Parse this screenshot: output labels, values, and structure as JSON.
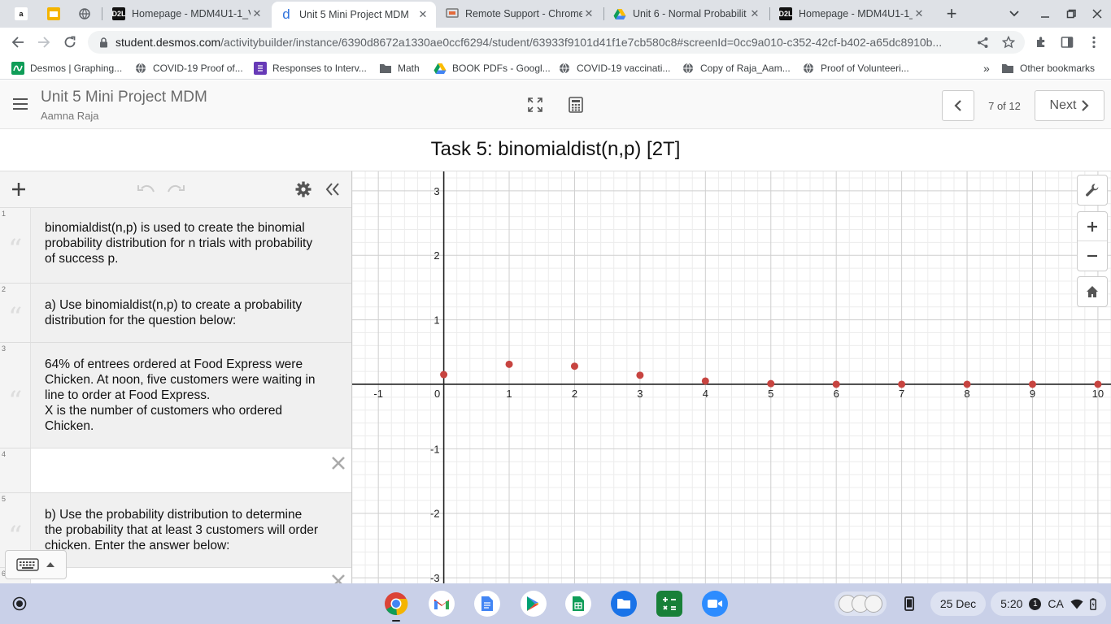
{
  "tabs": [
    {
      "label": "",
      "favicon": "amazon-icon"
    },
    {
      "label": "",
      "favicon": "slides-icon"
    },
    {
      "label": "",
      "favicon": "globe-icon"
    },
    {
      "label": "Homepage - MDM4U1-1_V",
      "favicon": "d2l-icon"
    },
    {
      "label": "Unit 5 Mini Project MDM",
      "favicon": "desmos-icon",
      "active": true
    },
    {
      "label": "Remote Support - Chrome",
      "favicon": "remote-desktop-icon"
    },
    {
      "label": "Unit 6 - Normal Probabilit",
      "favicon": "drive-icon"
    },
    {
      "label": "Homepage - MDM4U1-1_V",
      "favicon": "d2l-icon"
    }
  ],
  "address": {
    "host": "student.desmos.com",
    "path": "/activitybuilder/instance/6390d8672a1330ae0ccf6294/student/63933f9101d41f1e7cb580c8#screenId=0cc9a010-c352-42cf-b402-a65dc8910b..."
  },
  "bookmarks": [
    {
      "label": "Desmos | Graphing...",
      "icon": "desmos-icon"
    },
    {
      "label": "COVID-19 Proof of...",
      "icon": "globe-icon"
    },
    {
      "label": "Responses to Interv...",
      "icon": "forms-icon"
    },
    {
      "label": "Math",
      "icon": "folder-icon"
    },
    {
      "label": "BOOK PDFs - Googl...",
      "icon": "drive-icon"
    },
    {
      "label": "COVID-19 vaccinati...",
      "icon": "globe-icon"
    },
    {
      "label": "Copy of Raja_Aam...",
      "icon": "globe-icon"
    },
    {
      "label": "Proof of Volunteeri...",
      "icon": "globe-icon"
    }
  ],
  "bookmarks_more": "»",
  "bookmarks_other": "Other bookmarks",
  "activity": {
    "title": "Unit 5 Mini Project MDM",
    "student": "Aamna Raja",
    "pager": "7 of 12",
    "next_label": "Next"
  },
  "screen_title": "Task 5: binomialdist(n,p) [2T]",
  "expressions": [
    {
      "num": "1",
      "type": "note",
      "text": "binomialdist(n,p) is used to create the binomial probability distribution for n trials with probability of success p."
    },
    {
      "num": "2",
      "type": "note",
      "text": "a) Use binomialdist(n,p) to create a probability distribution for the question below:"
    },
    {
      "num": "3",
      "type": "note",
      "lines": [
        "64% of entrees ordered at Food Express were Chicken. At noon, five customers were waiting in line to order at Food Express.",
        "X is the number of customers who ordered Chicken."
      ]
    },
    {
      "num": "4",
      "type": "input",
      "text": ""
    },
    {
      "num": "5",
      "type": "note",
      "text": "b) Use the probability distribution to determine the probability that at least 3 customers will order chicken. Enter the answer below:"
    },
    {
      "num": "6",
      "type": "input",
      "text": ""
    }
  ],
  "quote_glyph": "“",
  "chart_data": {
    "type": "scatter",
    "x_ticks": [
      "-1",
      "0",
      "1",
      "2",
      "3",
      "4",
      "5",
      "6",
      "7",
      "8",
      "9",
      "10"
    ],
    "y_ticks": [
      "3",
      "2",
      "1",
      "-1",
      "-2",
      "-3"
    ],
    "xlim": [
      -1.4,
      10.2
    ],
    "ylim": [
      -3.1,
      3.3
    ],
    "grid": true,
    "point_color": "#c74440",
    "points": [
      {
        "x": 0,
        "y": 0.15
      },
      {
        "x": 1,
        "y": 0.31
      },
      {
        "x": 2,
        "y": 0.28
      },
      {
        "x": 3,
        "y": 0.14
      },
      {
        "x": 4,
        "y": 0.05
      },
      {
        "x": 5,
        "y": 0.01
      },
      {
        "x": 6,
        "y": 0
      },
      {
        "x": 7,
        "y": 0
      },
      {
        "x": 8,
        "y": 0
      },
      {
        "x": 9,
        "y": 0
      },
      {
        "x": 10,
        "y": 0
      }
    ]
  },
  "shelf": {
    "apps": [
      "chrome-icon",
      "gmail-icon",
      "docs-icon",
      "play-store-icon",
      "sheets-icon",
      "files-icon",
      "calculator-icon",
      "zoom-icon"
    ],
    "date": "25 Dec",
    "time": "5:20",
    "notification_count": "1",
    "locale": "CA"
  }
}
